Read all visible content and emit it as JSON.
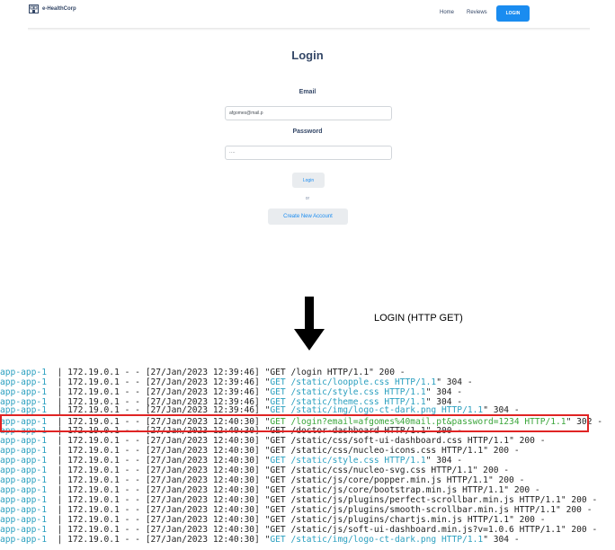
{
  "navbar": {
    "brand": "e-HealthCorp",
    "links": [
      "Home",
      "Reviews"
    ],
    "login_button": "LOGIN"
  },
  "form": {
    "title": "Login",
    "email_label": "Email",
    "email_value": "afgomes@mail.p",
    "password_label": "Password",
    "password_value": "····",
    "login_button": "Login",
    "or_text": "or",
    "create_button": "Create New Account"
  },
  "annotation": {
    "arrow_label": "LOGIN (HTTP GET)"
  },
  "log": {
    "prefix": "app-app-1",
    "separator": "|",
    "lines": [
      {
        "meta": "172.19.0.1 - - [27/Jan/2023 12:39:46] \"",
        "req": "GET /login HTTP/1.1",
        "suffix": "\" 200 -",
        "color": "plain"
      },
      {
        "meta": "172.19.0.1 - - [27/Jan/2023 12:39:46] \"",
        "req": "GET /static/loopple.css HTTP/1.1",
        "suffix": "\" 304 -",
        "color": "cyan"
      },
      {
        "meta": "172.19.0.1 - - [27/Jan/2023 12:39:46] \"",
        "req": "GET /static/style.css HTTP/1.1",
        "suffix": "\" 304 -",
        "color": "cyan"
      },
      {
        "meta": "172.19.0.1 - - [27/Jan/2023 12:39:46] \"",
        "req": "GET /static/theme.css HTTP/1.1",
        "suffix": "\" 304 -",
        "color": "cyan"
      },
      {
        "meta": "172.19.0.1 - - [27/Jan/2023 12:39:46] \"",
        "req": "GET /static/img/logo-ct-dark.png HTTP/1.1",
        "suffix": "\" 304 -",
        "color": "cyan"
      },
      {
        "meta": "172.19.0.1 - - [27/Jan/2023 12:40:30] \"",
        "req": "GET /login?email=afgomes%40mail.pt&password=1234 HTTP/1.1",
        "suffix": "\" 302 -",
        "color": "green"
      },
      {
        "meta": "172.19.0.1 - - [27/Jan/2023 12:40:30] \"",
        "req": "GET /doctor-dashboard HTTP/1.1",
        "suffix": "\" 200 -",
        "color": "plain"
      },
      {
        "meta": "172.19.0.1 - - [27/Jan/2023 12:40:30] \"",
        "req": "GET /static/css/soft-ui-dashboard.css HTTP/1.1",
        "suffix": "\" 200 -",
        "color": "plain"
      },
      {
        "meta": "172.19.0.1 - - [27/Jan/2023 12:40:30] \"",
        "req": "GET /static/css/nucleo-icons.css HTTP/1.1",
        "suffix": "\" 200 -",
        "color": "plain"
      },
      {
        "meta": "172.19.0.1 - - [27/Jan/2023 12:40:30] \"",
        "req": "GET /static/style.css HTTP/1.1",
        "suffix": "\" 304 -",
        "color": "cyan"
      },
      {
        "meta": "172.19.0.1 - - [27/Jan/2023 12:40:30] \"",
        "req": "GET /static/css/nucleo-svg.css HTTP/1.1",
        "suffix": "\" 200 -",
        "color": "plain"
      },
      {
        "meta": "172.19.0.1 - - [27/Jan/2023 12:40:30] \"",
        "req": "GET /static/js/core/popper.min.js HTTP/1.1",
        "suffix": "\" 200 -",
        "color": "plain"
      },
      {
        "meta": "172.19.0.1 - - [27/Jan/2023 12:40:30] \"",
        "req": "GET /static/js/core/bootstrap.min.js HTTP/1.1",
        "suffix": "\" 200 -",
        "color": "plain"
      },
      {
        "meta": "172.19.0.1 - - [27/Jan/2023 12:40:30] \"",
        "req": "GET /static/js/plugins/perfect-scrollbar.min.js HTTP/1.1",
        "suffix": "\" 200 -",
        "color": "plain"
      },
      {
        "meta": "172.19.0.1 - - [27/Jan/2023 12:40:30] \"",
        "req": "GET /static/js/plugins/smooth-scrollbar.min.js HTTP/1.1",
        "suffix": "\" 200 -",
        "color": "plain"
      },
      {
        "meta": "172.19.0.1 - - [27/Jan/2023 12:40:30] \"",
        "req": "GET /static/js/plugins/chartjs.min.js HTTP/1.1",
        "suffix": "\" 200 -",
        "color": "plain"
      },
      {
        "meta": "172.19.0.1 - - [27/Jan/2023 12:40:30] \"",
        "req": "GET /static/js/soft-ui-dashboard.min.js?v=1.0.6 HTTP/1.1",
        "suffix": "\" 200 -",
        "color": "plain"
      },
      {
        "meta": "172.19.0.1 - - [27/Jan/2023 12:40:30] \"",
        "req": "GET /static/img/logo-ct-dark.png HTTP/1.1",
        "suffix": "\" 304 -",
        "color": "cyan"
      }
    ]
  },
  "colors": {
    "accent": "#1a8cf0",
    "log_cyan": "#2a9fbf",
    "log_green": "#3aa53a",
    "highlight": "#e02424"
  },
  "icons": {
    "brand": "hospital-building-icon",
    "arrow": "arrow-down-icon"
  }
}
